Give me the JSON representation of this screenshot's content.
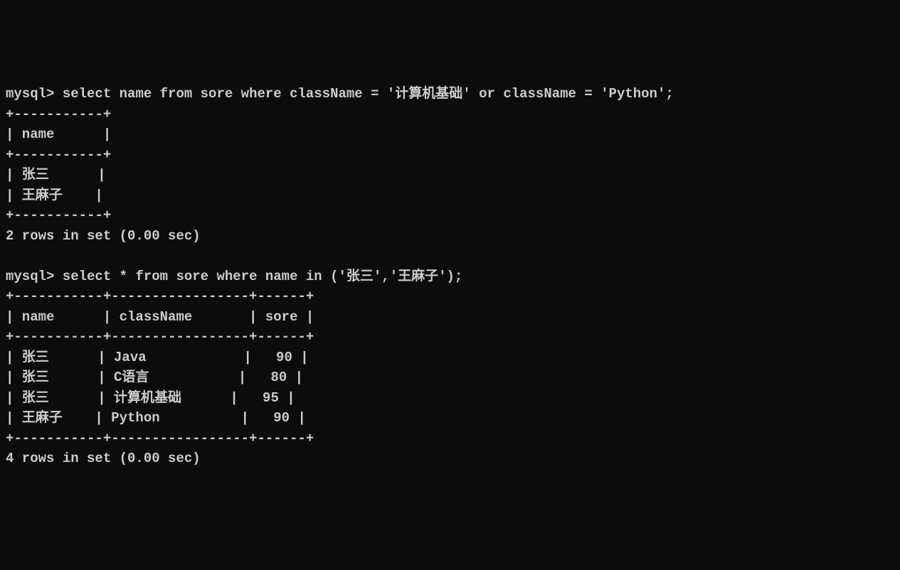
{
  "query1": {
    "prompt": "mysql> ",
    "sql": "select name from sore where className = '计算机基础' or className = 'Python';",
    "border_top": "+-----------+",
    "header_row": "| name      |",
    "border_mid": "+-----------+",
    "rows": [
      "| 张三      |",
      "| 王麻子    |"
    ],
    "border_bottom": "+-----------+",
    "summary": "2 rows in set (0.00 sec)"
  },
  "query2": {
    "prompt": "mysql> ",
    "sql": "select * from sore where name in ('张三','王麻子');",
    "border_top": "+-----------+-----------------+------+",
    "header_row": "| name      | className       | sore |",
    "border_mid": "+-----------+-----------------+------+",
    "rows": [
      "| 张三      | Java            |   90 |",
      "| 张三      | C语言           |   80 |",
      "| 张三      | 计算机基础      |   95 |",
      "| 王麻子    | Python          |   90 |"
    ],
    "border_bottom": "+-----------+-----------------+------+",
    "summary": "4 rows in set (0.00 sec)"
  }
}
